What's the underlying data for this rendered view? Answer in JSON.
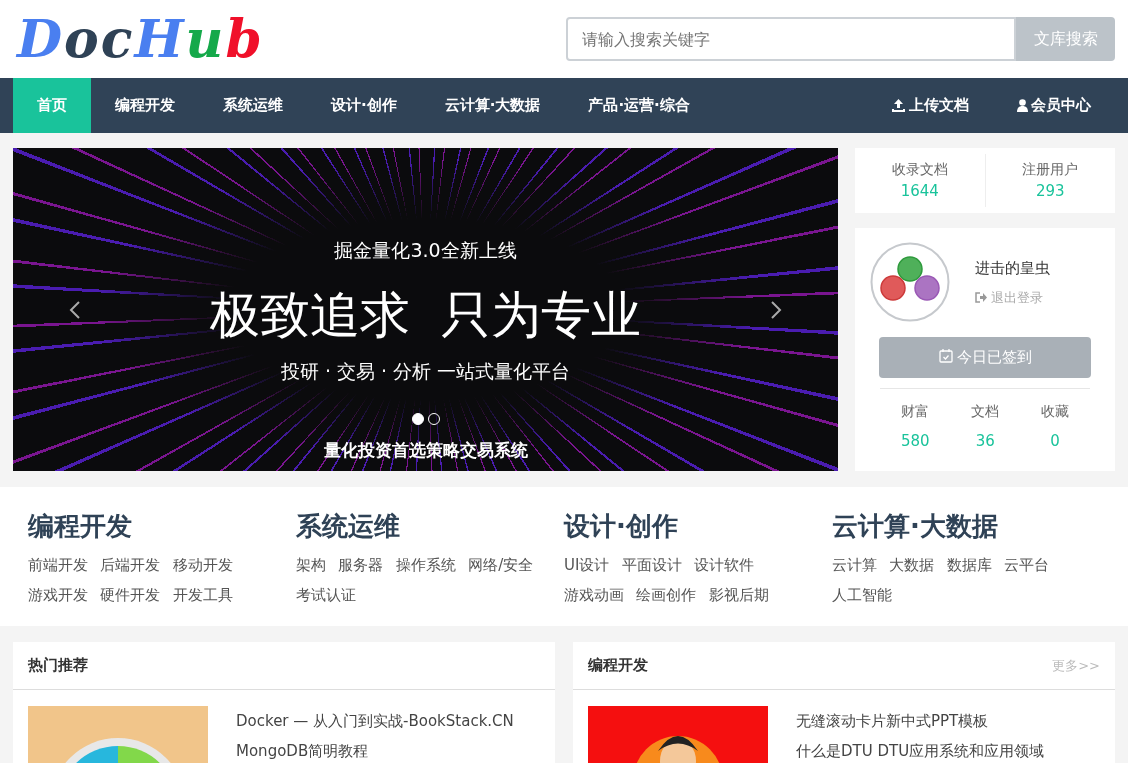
{
  "logo": {
    "letters": [
      {
        "char": "D",
        "color": "#4a7ff0"
      },
      {
        "char": "o",
        "color": "#2f4256"
      },
      {
        "char": "c",
        "color": "#2f4256"
      },
      {
        "char": "H",
        "color": "#4a7ff0"
      },
      {
        "char": "u",
        "color": "#15a94a"
      },
      {
        "char": "b",
        "color": "#f0102a"
      }
    ]
  },
  "search": {
    "placeholder": "请输入搜索关键字",
    "button": "文库搜索"
  },
  "nav": {
    "items": [
      {
        "label": "首页",
        "selected": true
      },
      {
        "label": "编程开发",
        "selected": false
      },
      {
        "label": "系统运维",
        "selected": false
      },
      {
        "label": "设计·创作",
        "selected": false
      },
      {
        "label": "云计算·大数据",
        "selected": false
      },
      {
        "label": "产品·运营·综合",
        "selected": false
      }
    ],
    "right": [
      {
        "label": "上传文档",
        "kind": "upload"
      },
      {
        "label": "会员中心",
        "kind": "user"
      }
    ]
  },
  "carousel": {
    "subtitle": "掘金量化3.0全新上线",
    "headline": "极致追求  只为专业",
    "tagline": "投研 · 交易 · 分析 一站式量化平台",
    "caption": "量化投资首选策略交易系统",
    "indicators": [
      {
        "selected": true
      },
      {
        "selected": false
      }
    ]
  },
  "site_stats": [
    {
      "label": "收录文档",
      "value": "1644"
    },
    {
      "label": "注册用户",
      "value": "293"
    }
  ],
  "user": {
    "name": "进击的皇虫",
    "logout": "退出登录",
    "checkin": {
      "label": "今日已签到",
      "disabled": true
    },
    "stats": [
      {
        "label": "财富",
        "value": "580"
      },
      {
        "label": "文档",
        "value": "36"
      },
      {
        "label": "收藏",
        "value": "0"
      }
    ]
  },
  "categories": [
    {
      "title": "编程开发",
      "links": [
        "前端开发",
        "后端开发",
        "移动开发",
        "游戏开发",
        "硬件开发",
        "开发工具"
      ]
    },
    {
      "title": "系统运维",
      "links": [
        "架构",
        "服务器",
        "操作系统",
        "网络/安全",
        "考试认证"
      ]
    },
    {
      "title": "设计·创作",
      "links": [
        "UI设计",
        "平面设计",
        "设计软件",
        "游戏动画",
        "绘画创作",
        "影视后期"
      ]
    },
    {
      "title": "云计算·大数据",
      "links": [
        "云计算",
        "大数据",
        "数据库",
        "云平台",
        "人工智能"
      ]
    }
  ],
  "panels": [
    {
      "title": "热门推荐",
      "kind": "clock",
      "items": [
        "Docker — 从入门到实战-BookStack.CN",
        "MongoDB简明教程"
      ]
    },
    {
      "title": "编程开发",
      "more": "更多>>",
      "kind": "cartoon",
      "items": [
        "无缝滚动卡片新中式PPT模板",
        "什么是DTU DTU应用系统和应用领域"
      ]
    }
  ]
}
